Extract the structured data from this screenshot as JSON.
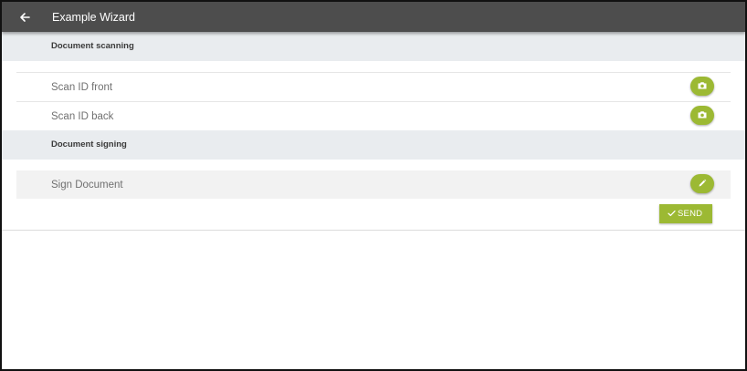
{
  "appbar": {
    "title": "Example Wizard",
    "back_icon": "arrow-left-icon",
    "background": "#4d4d4d"
  },
  "sections": [
    {
      "title": "Document scanning",
      "items": [
        {
          "label": "Scan ID front",
          "icon": "camera-icon"
        },
        {
          "label": "Scan ID back",
          "icon": "camera-icon"
        }
      ]
    },
    {
      "title": "Document signing",
      "items": [
        {
          "label": "Sign Document",
          "icon": "pencil-icon"
        }
      ]
    }
  ],
  "actions": {
    "send_label": "SEND",
    "send_icon": "checkmark-icon"
  },
  "colors": {
    "accent": "#9cb933",
    "section_header_bg": "#e9ecef",
    "item_label": "#707070"
  }
}
